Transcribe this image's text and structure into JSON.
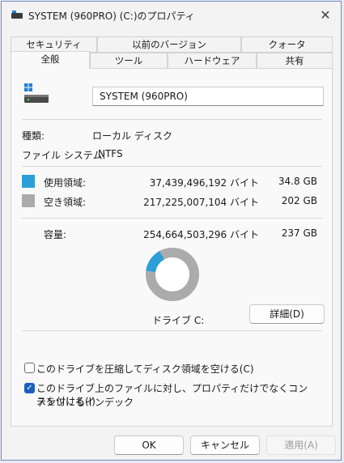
{
  "window": {
    "title": "SYSTEM (960PRO) (C:)のプロパティ",
    "close_glyph": "✕"
  },
  "tabs": {
    "row1": [
      "セキュリティ",
      "以前のバージョン",
      "クォータ"
    ],
    "row2": [
      "全般",
      "ツール",
      "ハードウェア",
      "共有"
    ],
    "active": "全般"
  },
  "general": {
    "drive_name": "SYSTEM (960PRO)",
    "type_label": "種類:",
    "type_value": "ローカル ディスク",
    "fs_label": "ファイル システム:",
    "fs_value": "NTFS",
    "used_label": "使用領域:",
    "used_bytes": "37,439,496,192 バイト",
    "used_size": "34.8 GB",
    "free_label": "空き領域:",
    "free_bytes": "217,225,007,104 バイト",
    "free_size": "202 GB",
    "capacity_label": "容量:",
    "capacity_bytes": "254,664,503,296 バイト",
    "capacity_size": "237 GB",
    "drive_label": "ドライブ C:",
    "details_button": "詳細(D)",
    "used_color": "#2a9fd8",
    "free_color": "#ababab",
    "used_fraction": 0.147
  },
  "options": {
    "compress": {
      "label": "このドライブを圧縮してディスク領域を空ける(C)",
      "checked": false
    },
    "index": {
      "label_line1": "このドライブ上のファイルに対し、プロパティだけでなくコンテンツにもインデック",
      "label_line2": "スを付ける(I)",
      "checked": true
    }
  },
  "buttons": {
    "ok": "OK",
    "cancel": "キャンセル",
    "apply": "適用(A)"
  }
}
